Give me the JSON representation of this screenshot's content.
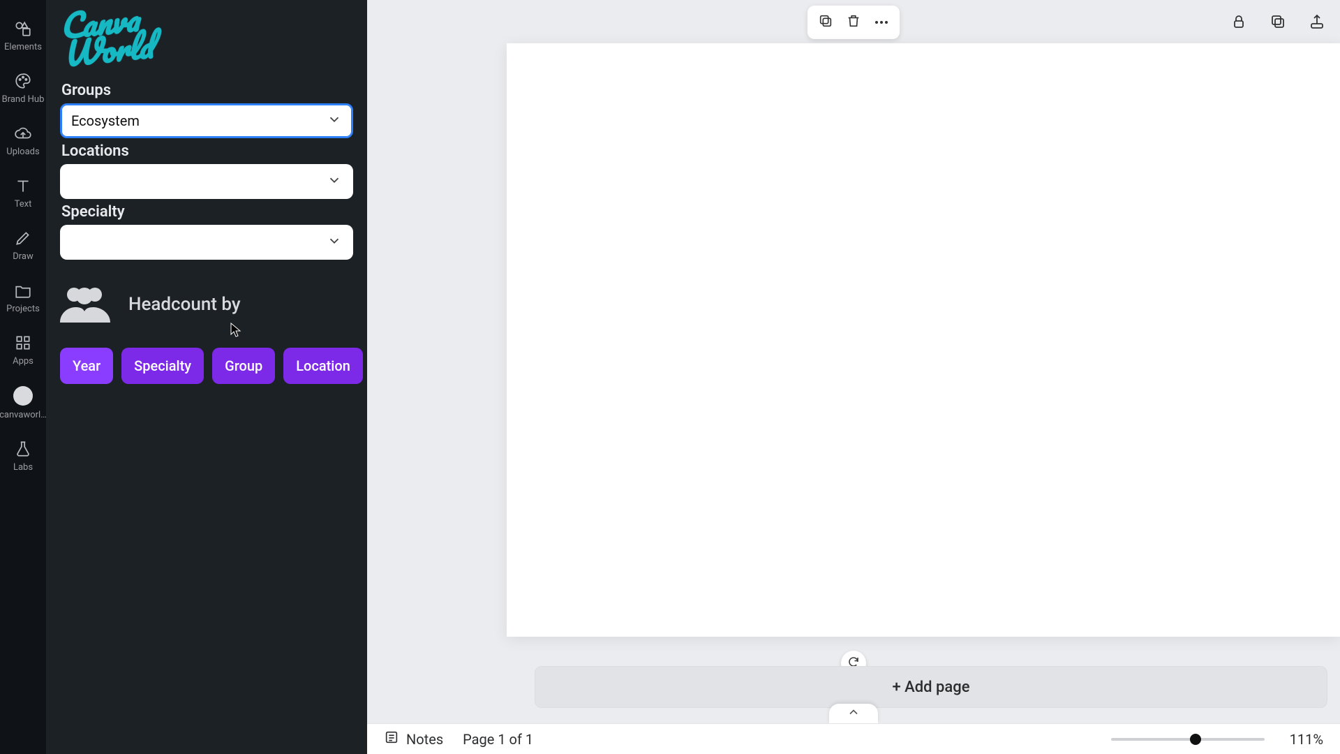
{
  "rail": {
    "items": [
      {
        "label": "Elements"
      },
      {
        "label": "Brand Hub"
      },
      {
        "label": "Uploads"
      },
      {
        "label": "Text"
      },
      {
        "label": "Draw"
      },
      {
        "label": "Projects"
      },
      {
        "label": "Apps"
      },
      {
        "label": "canvaworl…"
      },
      {
        "label": "Labs"
      }
    ]
  },
  "panel": {
    "logo_text": "Canva\nWorld",
    "groups_label": "Groups",
    "groups_value": "Ecosystem",
    "locations_label": "Locations",
    "locations_value": "",
    "specialty_label": "Specialty",
    "specialty_value": "",
    "headcount_label": "Headcount by",
    "chips": [
      "Year",
      "Specialty",
      "Group",
      "Location"
    ]
  },
  "footer": {
    "add_page_label": "+ Add page",
    "notes_label": "Notes",
    "page_counter": "Page 1 of 1",
    "zoom_label": "111%",
    "zoom_thumb_percent": 55
  }
}
